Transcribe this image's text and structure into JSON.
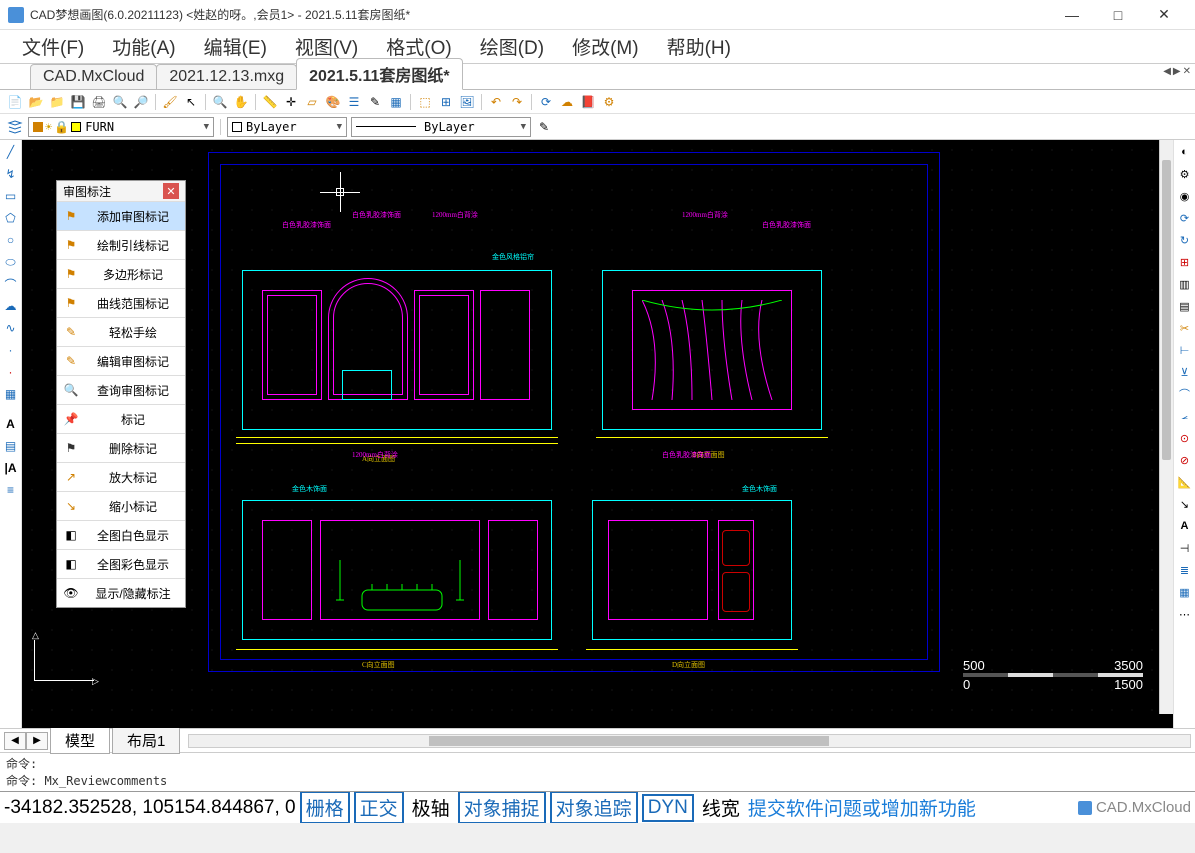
{
  "window": {
    "title": "CAD梦想画图(6.0.20211123) <姓赵的呀。,会员1> - 2021.5.11套房图纸*"
  },
  "menu": [
    "文件(F)",
    "功能(A)",
    "编辑(E)",
    "视图(V)",
    "格式(O)",
    "绘图(D)",
    "修改(M)",
    "帮助(H)"
  ],
  "tabs": [
    {
      "label": "CAD.MxCloud",
      "active": false
    },
    {
      "label": "2021.12.13.mxg",
      "active": false
    },
    {
      "label": "2021.5.11套房图纸*",
      "active": true
    }
  ],
  "layer_selector": {
    "value": "FURN"
  },
  "color_selector": {
    "value": "ByLayer"
  },
  "linetype_selector": {
    "value": "ByLayer"
  },
  "panel": {
    "title": "审图标注",
    "items": [
      {
        "label": "添加审图标记",
        "icon": "flag",
        "active": true
      },
      {
        "label": "绘制引线标记",
        "icon": "flag",
        "active": false
      },
      {
        "label": "多边形标记",
        "icon": "flag",
        "active": false
      },
      {
        "label": "曲线范围标记",
        "icon": "flag",
        "active": false
      },
      {
        "label": "轻松手绘",
        "icon": "pencil",
        "active": false
      },
      {
        "label": "编辑审图标记",
        "icon": "edit",
        "active": false
      },
      {
        "label": "查询审图标记",
        "icon": "search",
        "active": false
      },
      {
        "label": "标记",
        "icon": "pin",
        "active": false
      },
      {
        "label": "删除标记",
        "icon": "delete-flag",
        "active": false
      },
      {
        "label": "放大标记",
        "icon": "zoom-in",
        "active": false
      },
      {
        "label": "缩小标记",
        "icon": "zoom-out",
        "active": false
      },
      {
        "label": "全图白色显示",
        "icon": "display",
        "active": false
      },
      {
        "label": "全图彩色显示",
        "icon": "display",
        "active": false
      },
      {
        "label": "显示/隐藏标注",
        "icon": "eye",
        "active": false
      }
    ]
  },
  "layout_tabs": [
    "模型",
    "布局1"
  ],
  "cmd": {
    "line1": "命令:",
    "line2": "命令: Mx_Reviewcomments"
  },
  "status": {
    "coords": "-34182.352528, 105154.844867, 0",
    "toggles": [
      {
        "label": "栅格",
        "on": true
      },
      {
        "label": "正交",
        "on": true
      },
      {
        "label": "极轴",
        "on": false
      },
      {
        "label": "对象捕捉",
        "on": true
      },
      {
        "label": "对象追踪",
        "on": true
      },
      {
        "label": "DYN",
        "on": true
      },
      {
        "label": "线宽",
        "on": false
      }
    ],
    "link": "提交软件问题或增加新功能",
    "brand": "CAD.MxCloud"
  },
  "scale": {
    "top_left": "500",
    "top_right": "3500",
    "bot_left": "0",
    "bot_right": "1500"
  },
  "drawing_labels": {
    "a1": "白色乳胶漆饰面",
    "a2": "白色乳胶漆饰面",
    "a3": "1200mm白背涂",
    "b1": "白色乳胶漆饰面",
    "b2": "金色风格铝帘",
    "b3": "白色乳胶漆饰面",
    "c1": "1200mm白背涂",
    "c2": "白色乳胶漆饰面",
    "c3": "金色木饰面",
    "d1": "1200mm白背涂",
    "d2": "白色乳胶漆饰面",
    "title1": "A向立面图",
    "title2": "B向立面图",
    "title3": "C向立面图",
    "title4": "D向立面图"
  }
}
